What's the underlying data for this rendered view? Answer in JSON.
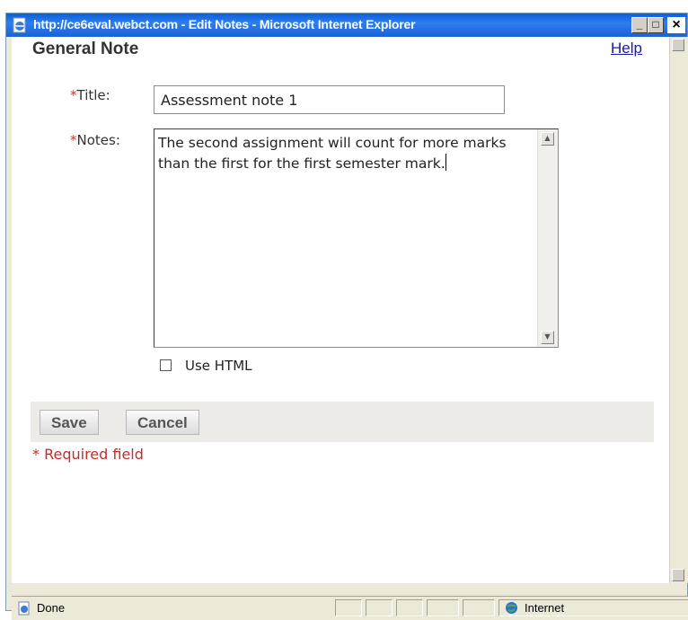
{
  "window": {
    "title": "http://ce6eval.webct.com - Edit Notes - Microsoft Internet Explorer",
    "minimize_label": "_",
    "maximize_label": "□",
    "close_label": "×"
  },
  "page": {
    "heading": "General Note",
    "help_link": "Help"
  },
  "form": {
    "required_marker": "*",
    "title_label": "Title:",
    "title_value": "Assessment note 1",
    "notes_label": "Notes:",
    "notes_value": "The second assignment will count for more marks than the first for the first semester mark.",
    "use_html_label": "Use HTML",
    "use_html_checked": false
  },
  "buttons": {
    "save": "Save",
    "cancel": "Cancel"
  },
  "footer": {
    "required_note": "* Required field"
  },
  "status_bar": {
    "status": "Done",
    "zone": "Internet"
  }
}
